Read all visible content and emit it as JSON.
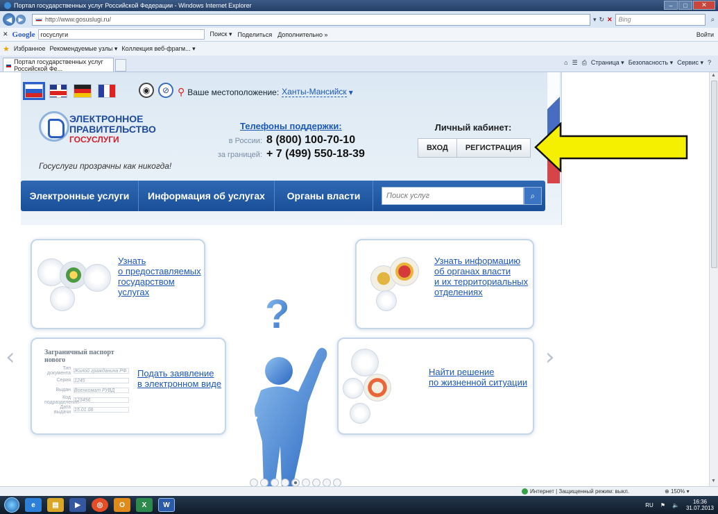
{
  "browser": {
    "window_title": "Портал государственных услуг Российской Федерации - Windows Internet Explorer",
    "url": "http://www.gosuslugi.ru/",
    "search_engine_placeholder": "Bing",
    "google": {
      "logo": "Google",
      "query": "госуслуги",
      "search_label": "Поиск ▾",
      "share_label": "Поделиться",
      "more_label": "Дополнительно »",
      "login_label": "Войти"
    },
    "favorites": {
      "label": "Избранное",
      "items": [
        "Рекомендуемые узлы ▾",
        "Коллекция веб-фрагм... ▾"
      ]
    },
    "tab_title": "Портал государственных услуг Российской Фе...",
    "commands": [
      "Страница ▾",
      "Безопасность ▾",
      "Сервис ▾"
    ]
  },
  "site": {
    "location_label": "Ваше местоположение:",
    "location_city": "Ханты-Мансийск",
    "logo_line1": "ЭЛЕКТРОННОЕ",
    "logo_line2": "ПРАВИТЕЛЬСТВО",
    "logo_line3": "ГОСУСЛУГИ",
    "tagline": "Госуслуги прозрачны как никогда!",
    "support": {
      "title": "Телефоны поддержки:",
      "russia_label": "в России:",
      "russia_number": "8 (800) 100-70-10",
      "abroad_label": "за границей:",
      "abroad_number": "+ 7 (499) 550-18-39"
    },
    "cabinet": {
      "title": "Личный кабинет:",
      "login": "ВХОД",
      "register": "РЕГИСТРАЦИЯ"
    },
    "nav": {
      "items": [
        "Электронные услуги",
        "Информация об услугах",
        "Органы власти"
      ],
      "search_placeholder": "Поиск услуг"
    },
    "bubbles": {
      "top_left": [
        "Узнать",
        "о предоставляемых",
        "государством",
        "услугах"
      ],
      "top_right": [
        "Узнать информацию",
        "об органах власти",
        "и их территориальных",
        "отделениях"
      ],
      "bottom_left": [
        "Подать заявление",
        "в электронном виде"
      ],
      "bottom_right": [
        "Найти решение",
        "по жизненной ситуации"
      ]
    },
    "doc_preview": {
      "title": "Заграничный паспорт нового",
      "lines": [
        "Тип документа",
        "Серия",
        "Выдан",
        "Код подразделения",
        "Дата выдачи"
      ],
      "fields": [
        "Жилой гражданина РФ",
        "1245",
        "Военкомат РУВД",
        "123456",
        "15.01.08"
      ]
    },
    "slides_total": 9,
    "slides_active": 5
  },
  "status": {
    "zone": "Интернет | Защищенный режим: выкл.",
    "zoom": "150%"
  },
  "tray": {
    "lang": "RU",
    "time": "16:36",
    "date": "31.07.2013"
  },
  "colors": {
    "brand_blue": "#1f4aa0",
    "nav_blue": "#2a5fb0",
    "link": "#1c58b7",
    "accent_red": "#d11e2a",
    "annotation_arrow": "#f5f000"
  }
}
